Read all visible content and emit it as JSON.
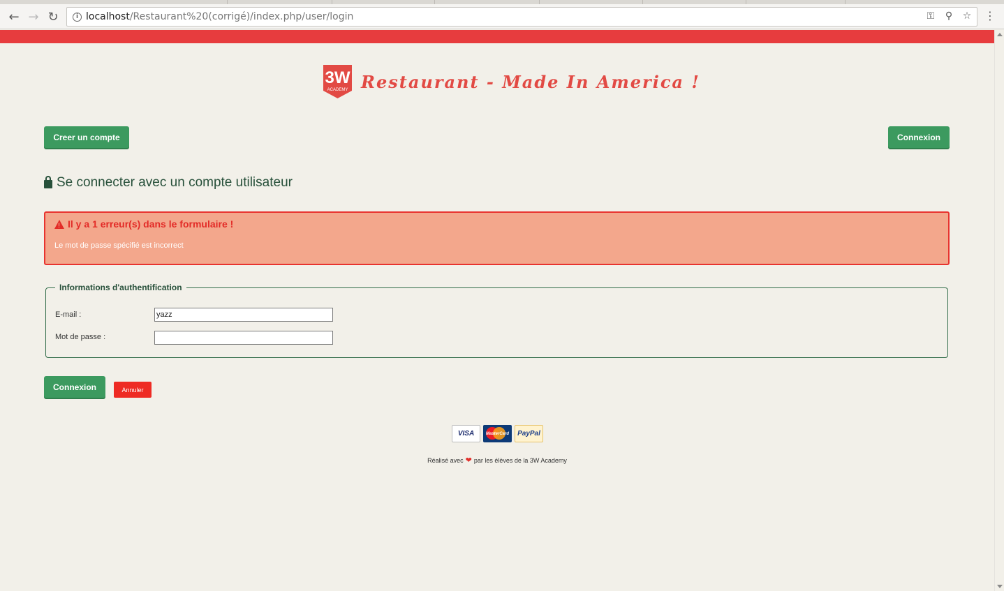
{
  "browser": {
    "url_host": "localhost",
    "url_path": "/Restaurant%20(corrigé)/index.php/user/login"
  },
  "site": {
    "logo_text": "3W",
    "logo_sub": "ACADEMY",
    "title": "Restaurant - Made In America !",
    "brand_red": "#e73c3e",
    "brand_green": "#3c9a5f"
  },
  "nav": {
    "create_account": "Creer un compte",
    "login": "Connexion"
  },
  "main": {
    "heading": "Se connecter avec un compte utilisateur",
    "alert": {
      "title": "Il y a 1 erreur(s) dans le formulaire !",
      "message": "Le mot de passe spécifié est incorrect"
    },
    "form": {
      "legend": "Informations d'authentification",
      "email_label": "E-mail :",
      "email_value": "yazz",
      "password_label": "Mot de passe :",
      "password_value": "",
      "submit": "Connexion",
      "cancel": "Annuler"
    }
  },
  "footer": {
    "payments": [
      "VISA",
      "MasterCard",
      "PayPal"
    ],
    "text_before": "Réalisé avec",
    "text_after": "par les élèves de la 3W Academy"
  }
}
